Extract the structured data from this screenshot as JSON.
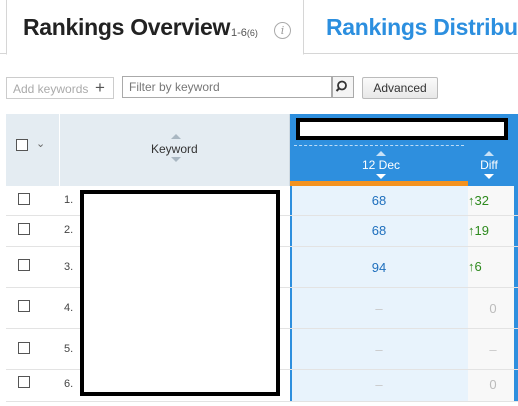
{
  "tabs": {
    "active": {
      "title": "Rankings Overview",
      "count": "1-6",
      "count_sub": "(6)",
      "info": "i"
    },
    "inactive": {
      "title": "Rankings Distributi"
    }
  },
  "toolbar": {
    "add_keywords_placeholder": "Add keywords",
    "add_icon": "+",
    "filter_placeholder": "Filter by keyword",
    "advanced_label": "Advanced"
  },
  "table": {
    "headers": {
      "keyword": "Keyword",
      "date": "12 Dec",
      "diff": "Diff"
    },
    "rows": [
      {
        "num": "1.",
        "position": "68",
        "diff": "32",
        "diff_arrow": "↑"
      },
      {
        "num": "2.",
        "position": "68",
        "diff": "19",
        "diff_arrow": "↑"
      },
      {
        "num": "3.",
        "position": "94",
        "diff": "6",
        "diff_arrow": "↑"
      },
      {
        "num": "4.",
        "position": "–",
        "diff": "0",
        "diff_arrow": ""
      },
      {
        "num": "5.",
        "position": "–",
        "diff": "–",
        "diff_arrow": ""
      },
      {
        "num": "6.",
        "position": "–",
        "diff": "0",
        "diff_arrow": ""
      }
    ]
  },
  "colors": {
    "accent_blue": "#2e8fde",
    "positive_green": "#2e8a1e",
    "orange_bar": "#f3921f",
    "position_blue": "#1e6fbd"
  }
}
